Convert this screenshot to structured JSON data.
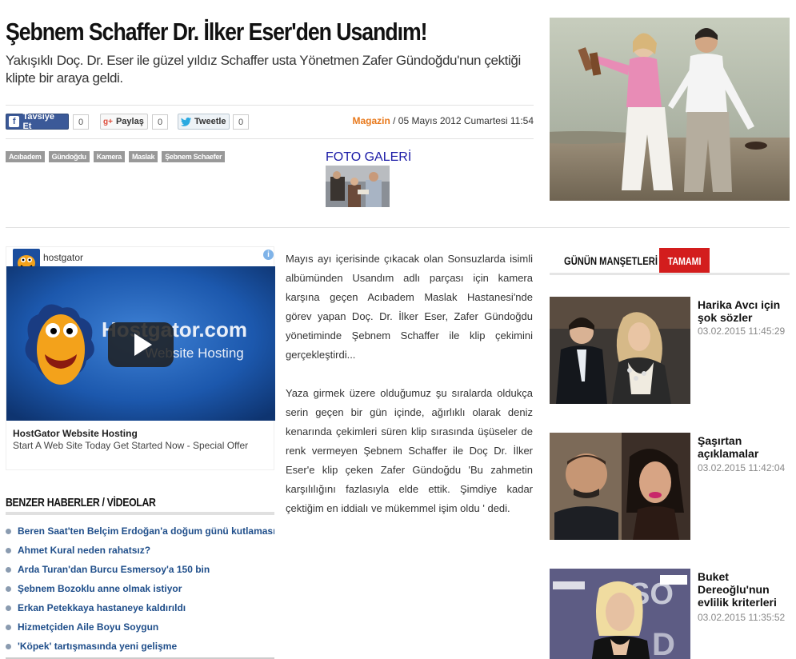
{
  "article": {
    "title": "Şebnem Schaffer Dr. İlker Eser'den Usandım!",
    "subtitle": "Yakışıklı Doç. Dr. Eser ile güzel yıldız Schaffer usta Yönetmen Zafer Gündoğdu'nun çektiği klipte bir araya geldi.",
    "category": "Magazin",
    "date": " / 05 Mayıs 2012 Cumartesi 11:54",
    "paragraphs": [
      "Mayıs ayı içerisinde çıkacak olan Sonsuzlarda isimli albümünden Usandım adlı parçası için kamera karşına geçen Acıbadem Maslak Hastanesi'nde görev yapan Doç. Dr. İlker Eser, Zafer Gündoğdu yönetiminde Şebnem Schaffer ile klip çekimini gerçekleştirdi...",
      "Yaza girmek üzere olduğumuz şu sıralarda oldukça serin geçen bir gün içinde, ağırlıklı olarak deniz kenarında çekimleri süren klip sırasında üşüseler de renk vermeyen Şebnem Schaffer ile Doç Dr. İlker Eser'e klip çeken Zafer Gündoğdu 'Bu zahmetin karşılılığını fazlasıyla elde ettik. Şimdiye kadar çektiğim en iddialı ve mükemmel işim oldu ' dedi."
    ]
  },
  "share": {
    "facebook_label": "Tavsiye Et",
    "facebook_count": "0",
    "gplus_label": "Paylaş",
    "gplus_count": "0",
    "twitter_label": "Tweetle",
    "twitter_count": "0"
  },
  "tags": [
    "Acıbadem",
    "Gündoğdu",
    "Kamera",
    "Maslak",
    "Şebnem Schaefer"
  ],
  "gallery": {
    "label": "FOTO GALERİ"
  },
  "ad": {
    "advertiser": "hostgator",
    "title": "HostGator Website Hosting",
    "description": "Start A Web Site Today Get Started Now - Special Offer",
    "video_text": "Hostgator.com",
    "video_sub": "Website Hosting"
  },
  "related": {
    "heading": "BENZER HABERLER / VİDEOLAR",
    "items": [
      "Beren Saat'ten Belçim Erdoğan'a doğum günü kutlaması",
      "Ahmet Kural neden rahatsız?",
      "Arda Turan'dan Burcu Esmersoy'a 150 bin",
      "Şebnem Bozoklu anne olmak istiyor",
      "Erkan Petekkaya hastaneye kaldırıldı",
      "Hizmetçiden Aile Boyu Soygun",
      "'Köpek' tartışmasında yeni gelişme"
    ]
  },
  "headlines": {
    "tab_label": "GÜNÜN MANŞETLERİ",
    "all_label": "TAMAMI",
    "items": [
      {
        "title": "Harika Avcı için şok sözler",
        "date": "03.02.2015 11:45:29"
      },
      {
        "title": "Şaşırtan açıklamalar",
        "date": "03.02.2015 11:42:04"
      },
      {
        "title": "Buket Dereoğlu'nun evlilik kriterleri",
        "date": "03.02.2015 11:35:52"
      }
    ]
  },
  "colors": {
    "accent_red": "#d31d1d",
    "category_orange": "#e8791c",
    "link_blue": "#1f4e8a",
    "facebook_blue": "#3b5998"
  }
}
